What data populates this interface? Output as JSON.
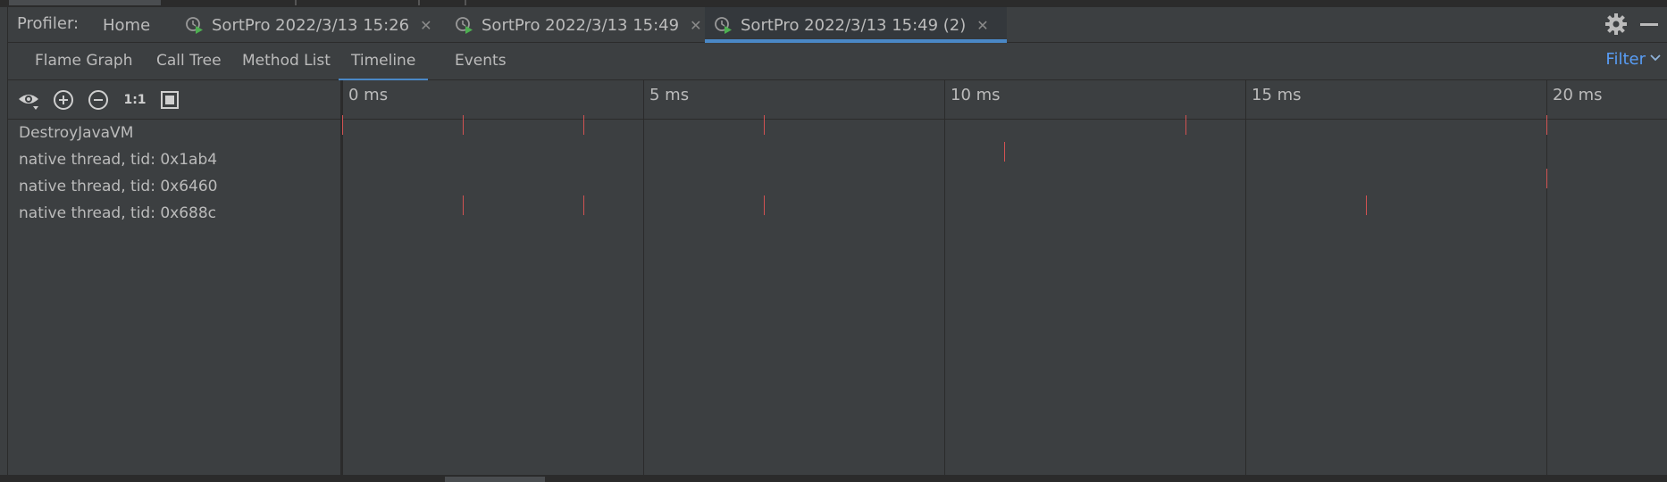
{
  "tabbar": {
    "profiler_label": "Profiler:",
    "tabs": [
      {
        "label": "Home",
        "icon": null,
        "closable": false,
        "active": false
      },
      {
        "label": "SortPro 2022/3/13 15:26",
        "icon": "profiler-run-icon",
        "closable": true,
        "active": false
      },
      {
        "label": "SortPro 2022/3/13 15:49",
        "icon": "profiler-run-icon",
        "closable": true,
        "active": false
      },
      {
        "label": "SortPro 2022/3/13 15:49 (2)",
        "icon": "profiler-run-icon",
        "closable": true,
        "active": true
      }
    ],
    "close_glyph": "✕"
  },
  "subtabs": {
    "items": [
      "Flame Graph",
      "Call Tree",
      "Method List",
      "Timeline",
      "Events"
    ],
    "active": "Timeline",
    "filter_label": "Filter"
  },
  "toolbar": {
    "icons": [
      "eye-icon",
      "zoom-in-icon",
      "zoom-out-icon",
      "actual-size-icon",
      "fit-icon"
    ],
    "actual_size_label": "1:1"
  },
  "threads": [
    "DestroyJavaVM",
    "native thread, tid: 0x1ab4",
    "native thread, tid: 0x6460",
    "native thread, tid: 0x688c"
  ],
  "timeline": {
    "ticks": [
      "0 ms",
      "5 ms",
      "10 ms",
      "15 ms",
      "20 ms"
    ],
    "events_ms": [
      [
        0.0,
        2.0,
        4.0,
        7.0,
        14.0,
        20.0
      ],
      [
        11.0
      ],
      [
        20.0
      ],
      [
        2.0,
        4.0,
        7.0,
        17.0
      ]
    ]
  },
  "colors": {
    "background": "#3c3f41",
    "accent": "#4a88c7",
    "filter": "#589df6",
    "event": "#d25252",
    "run_icon": "#4caf50"
  }
}
